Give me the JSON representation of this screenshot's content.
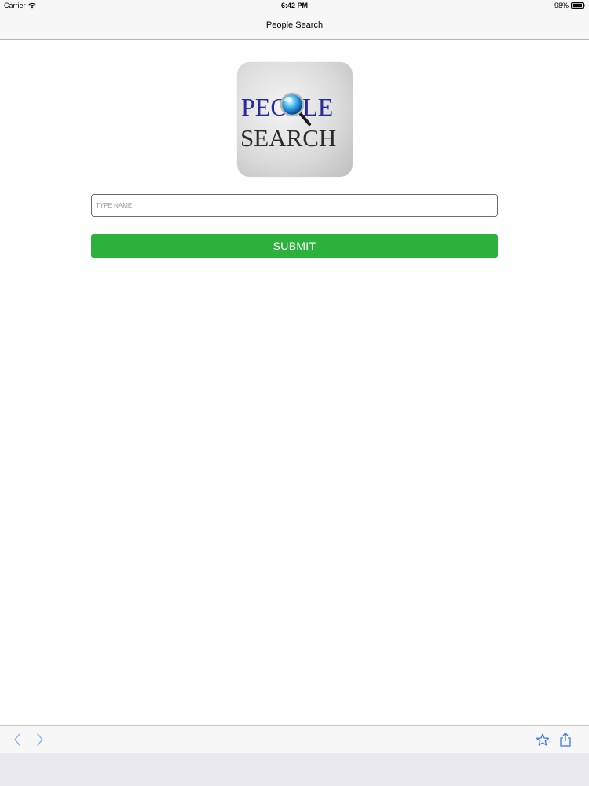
{
  "status_bar": {
    "carrier": "Carrier",
    "time": "6:42 PM",
    "battery": "98%"
  },
  "nav": {
    "title": "People Search"
  },
  "logo": {
    "line1": "PEOPLE",
    "line2": "SEARCH",
    "icon": "magnifier-icon"
  },
  "search": {
    "placeholder": "TYPE NAME",
    "value": ""
  },
  "submit": {
    "label": "SUBMIT"
  },
  "toolbar": {
    "icons": [
      "chevron-left-icon",
      "chevron-right-icon",
      "star-icon",
      "share-icon"
    ]
  },
  "colors": {
    "accent_green": "#2db13d",
    "toolbar_blue": "#3478f6",
    "logo_blue": "#2a2a9a"
  }
}
